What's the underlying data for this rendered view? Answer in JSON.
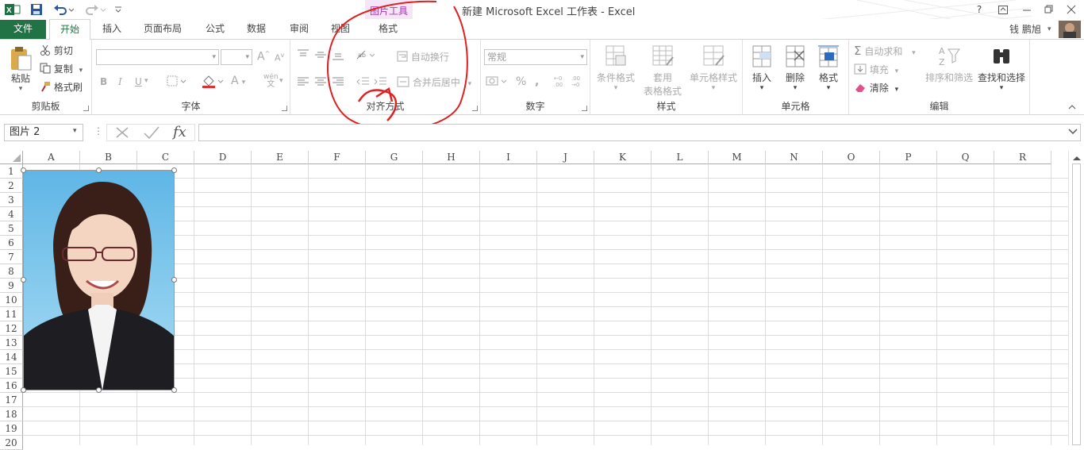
{
  "window": {
    "title": "新建 Microsoft Excel 工作表 - Excel",
    "context_tool_label": "图片工具",
    "help_label": "?",
    "user_name": "钱 鹏旭"
  },
  "tabs": {
    "file": "文件",
    "home": "开始",
    "insert": "插入",
    "page_layout": "页面布局",
    "formulas": "公式",
    "data": "数据",
    "review": "审阅",
    "view": "视图",
    "format": "格式"
  },
  "ribbon": {
    "clipboard": {
      "paste": "粘贴",
      "cut": "剪切",
      "copy": "复制",
      "format_painter": "格式刷",
      "label": "剪贴板"
    },
    "font": {
      "label": "字体",
      "bold": "B",
      "italic": "I",
      "underline": "U",
      "increase": "A",
      "decrease": "A",
      "font_color": "A",
      "wen": "wén",
      "wen2": "文"
    },
    "alignment": {
      "wrap_text": "自动换行",
      "merge_center": "合并后居中",
      "label": "对齐方式"
    },
    "number": {
      "format_value": "常规",
      "percent": "%",
      "comma": ",",
      "label": "数字"
    },
    "styles": {
      "conditional": "条件格式",
      "table_format_1": "套用",
      "table_format_2": "表格格式",
      "cell_styles": "单元格样式",
      "label": "样式"
    },
    "cells": {
      "insert": "插入",
      "delete": "删除",
      "format": "格式",
      "label": "单元格"
    },
    "editing": {
      "autosum": "自动求和",
      "fill": "填充",
      "clear": "清除",
      "sort_filter": "排序和筛选",
      "find_select": "查找和选择",
      "label": "编辑"
    }
  },
  "formula_bar": {
    "name_box": "图片 2",
    "fx_label": "fx",
    "content": ""
  },
  "sheet": {
    "columns": [
      "A",
      "B",
      "C",
      "D",
      "E",
      "F",
      "G",
      "H",
      "I",
      "J",
      "K",
      "L",
      "M",
      "N",
      "O",
      "P",
      "Q",
      "R"
    ],
    "rows": [
      "1",
      "2",
      "3",
      "4",
      "5",
      "6",
      "7",
      "8",
      "9",
      "10",
      "11",
      "12",
      "13",
      "14",
      "15",
      "16",
      "17",
      "18",
      "19",
      "20"
    ]
  },
  "colors": {
    "excel_green": "#217346",
    "annotation_red": "#e02020",
    "context_purple": "#a23bb1",
    "photo_bg": "#5fb6e6"
  }
}
